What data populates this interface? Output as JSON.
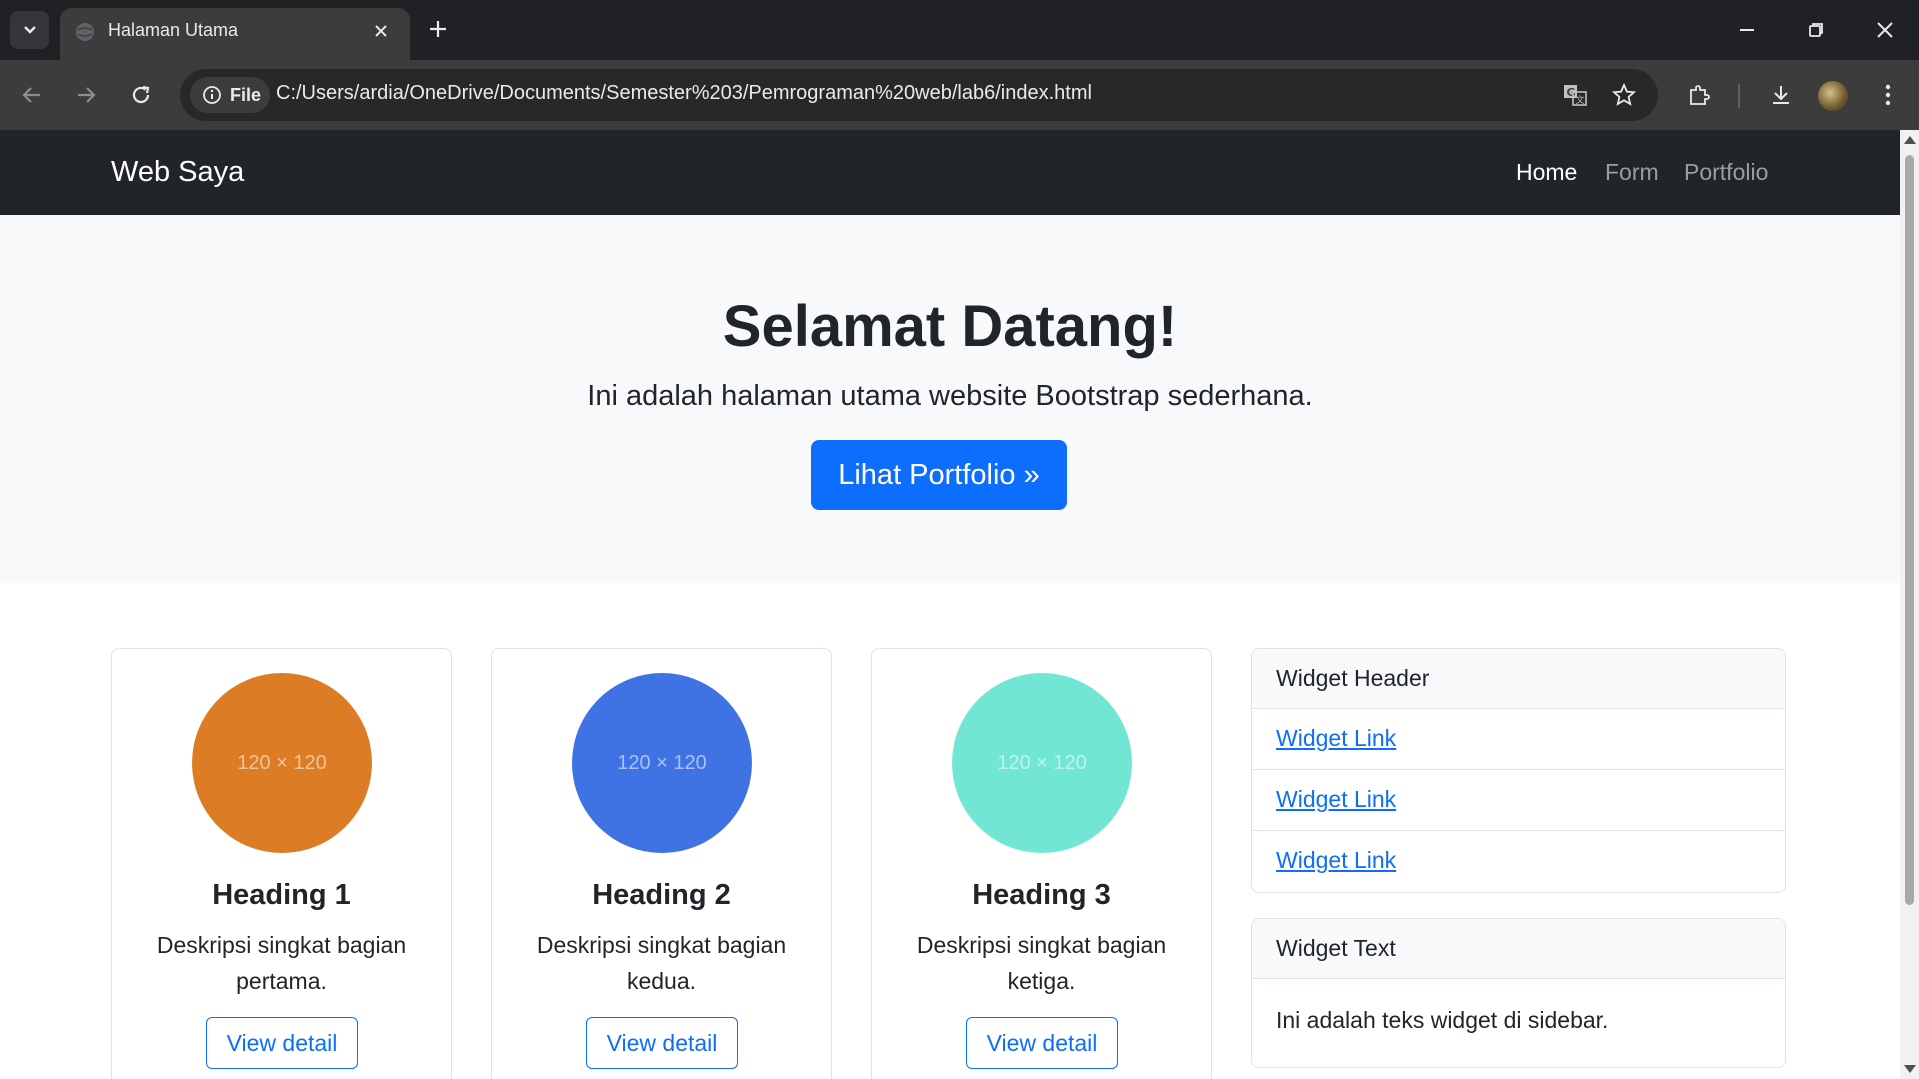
{
  "browser": {
    "tab_title": "Halaman Utama",
    "site_chip_label": "File",
    "url": "C:/Users/ardia/OneDrive/Documents/Semester%203/Pemrograman%20web/lab6/index.html"
  },
  "navbar": {
    "brand": "Web Saya",
    "links": [
      {
        "label": "Home",
        "active": true
      },
      {
        "label": "Form",
        "active": false
      },
      {
        "label": "Portfolio",
        "active": false
      }
    ]
  },
  "hero": {
    "title": "Selamat Datang!",
    "lead": "Ini adalah halaman utama website Bootstrap sederhana.",
    "button": "Lihat Portfolio »"
  },
  "cards": [
    {
      "image_label": "120 × 120",
      "color": "#dc7c24",
      "heading": "Heading 1",
      "description": "Deskripsi singkat bagian pertama.",
      "button": "View detail"
    },
    {
      "image_label": "120 × 120",
      "color": "#3f73e4",
      "heading": "Heading 2",
      "description": "Deskripsi singkat bagian kedua.",
      "button": "View detail"
    },
    {
      "image_label": "120 × 120",
      "color": "#72e6d4",
      "heading": "Heading 3",
      "description": "Deskripsi singkat bagian ketiga.",
      "button": "View detail"
    }
  ],
  "sidebar": {
    "widget1": {
      "header": "Widget Header",
      "links": [
        "Widget Link",
        "Widget Link",
        "Widget Link"
      ]
    },
    "widget2": {
      "header": "Widget Text",
      "body": "Ini adalah teks widget di sidebar."
    }
  },
  "colors": {
    "primary": "#0d6efd",
    "navbar_bg": "#212529",
    "hero_bg": "#f8f9fa"
  }
}
